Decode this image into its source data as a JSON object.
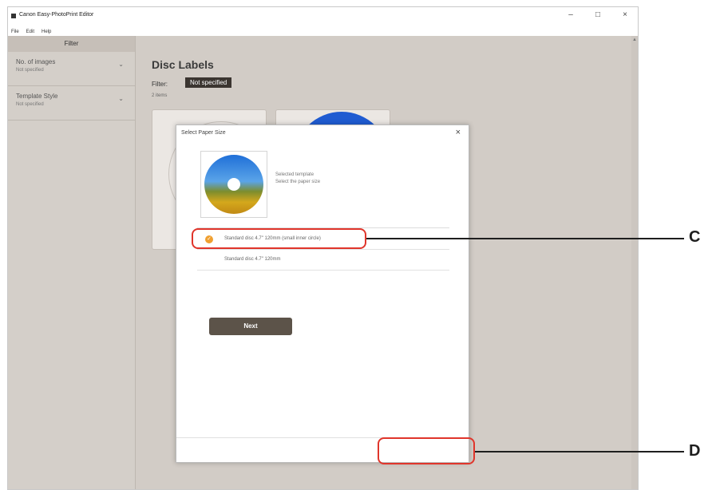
{
  "window": {
    "title": "Canon Easy-PhotoPrint Editor",
    "controls": {
      "minimize": "–",
      "maximize": "□",
      "close": "×"
    }
  },
  "menu": [
    "File",
    "Edit",
    "Help"
  ],
  "sidebar": {
    "header": "Filter",
    "items": [
      {
        "label": "No. of images",
        "value": "Not specified"
      },
      {
        "label": "Template Style",
        "value": "Not specified"
      }
    ]
  },
  "main": {
    "title": "Disc Labels",
    "filter_label": "Filter:",
    "filter_value": "Not specified",
    "count": "2 items"
  },
  "dialog": {
    "title": "Select Paper Size",
    "close": "×",
    "message_line1": "Selected template",
    "message_line2": "Select the paper size",
    "options": [
      {
        "label": "Standard disc 4.7\" 120mm (small inner circle)",
        "selected": true
      },
      {
        "label": "Standard disc 4.7\" 120mm",
        "selected": false
      }
    ],
    "check_mark": "✓",
    "next_button": "Next"
  },
  "callouts": {
    "c": "C",
    "d": "D"
  },
  "colors": {
    "accent": "#f0a030",
    "callout": "#e0352b",
    "button": "#5c5349",
    "disc_blue": "#1f5bd1"
  }
}
